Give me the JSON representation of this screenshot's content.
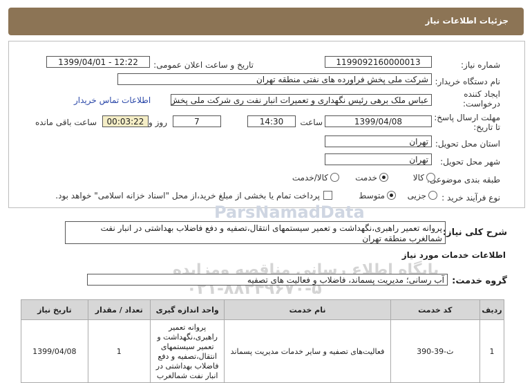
{
  "header": {
    "title": "جزئیات اطلاعات نیاز"
  },
  "form": {
    "need_number": {
      "label": "شماره نیاز:",
      "value": "1199092160000013"
    },
    "announce": {
      "label": "تاریخ و ساعت اعلان عمومی:",
      "value": "1399/04/01 - 12:22"
    },
    "buyer": {
      "label": "نام دستگاه خریدار:",
      "value": "شرکت ملی پخش فراورده های نفتی منطقه تهران"
    },
    "creator": {
      "label1": "ایجاد کننده",
      "label2": "درخواست:",
      "value": "عباس ملک برهی رئیس نگهداری و تعمیرات انبار نفت ری شرکت ملی پخش فراو",
      "contact_link": "اطلاعات تماس خریدار"
    },
    "deadline": {
      "label1": "مهلت ارسال پاسخ:",
      "label2": "تا تاریخ:",
      "date": "1399/04/08",
      "time_label": "ساعت",
      "time": "14:30",
      "days": "7",
      "days_label": "روز و",
      "remaining": "00:03:22",
      "remaining_label": "ساعت باقی مانده"
    },
    "province": {
      "label": "استان محل تحویل:",
      "value": "تهران"
    },
    "city": {
      "label": "شهر محل تحویل:",
      "value": "تهران"
    },
    "category": {
      "label": "طبقه بندی موضوعی:",
      "options": [
        "کالا",
        "خدمت",
        "کالا/خدمت"
      ],
      "selected": "خدمت"
    },
    "process": {
      "label": "نوع فرآیند خرید :",
      "options": [
        "جزیی",
        "متوسط"
      ],
      "selected": "متوسط",
      "checkbox_text": "پرداخت تمام یا بخشی از مبلغ خرید،از محل \"اسناد خزانه اسلامی\" خواهد بود."
    }
  },
  "summary": {
    "label": "شرح کلی نیاز:",
    "line1": "پروانه تعمیر راهبری،نگهداشت و تعمیر سیستمهای انتقال،تصفیه و دفع فاضلاب بهداشتی در انبار نفت",
    "line2": "شمالغرب منطقه تهران"
  },
  "services": {
    "heading": "اطلاعات خدمات مورد نیاز",
    "group_label": "گروه خدمت:",
    "group_value": "آب رسانی؛ مدیریت پسماند، فاضلاب و فعالیت های تصفیه"
  },
  "table": {
    "headers": [
      "ردیف",
      "کد خدمت",
      "نام خدمت",
      "واحد اندازه گیری",
      "تعداد / مقدار",
      "تاریخ نیاز"
    ],
    "rows": [
      [
        "1",
        "ث-39-390",
        "فعالیت‌های تصفیه و سایر خدمات مدیریت پسماند",
        "پروانه تعمیر راهبری،نگهداشت و تعمیر سیستمهای انتقال،تصفیه و دفع فاضلاب بهداشتی در انبار نفت شمالغرب",
        "1",
        "1399/04/08"
      ]
    ]
  },
  "watermark": {
    "line1": "ParsNamadData",
    "line2": "پایگاه اطلاع رسانی مناقصه ومزایده",
    "line3": "۰۲۱-۸۸۳۴۹۶۷۰-۵"
  }
}
